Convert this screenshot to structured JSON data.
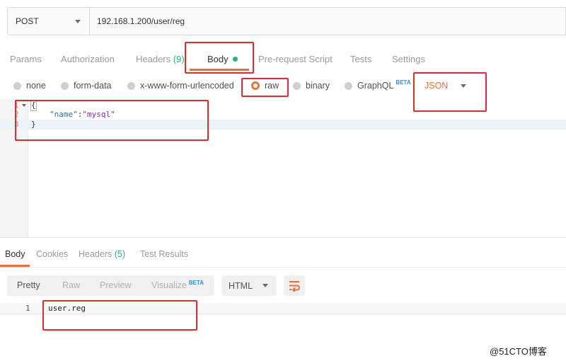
{
  "request": {
    "method": "POST",
    "url": "192.168.1.200/user/reg"
  },
  "request_tabs": {
    "params": "Params",
    "authorization": "Authorization",
    "headers": "Headers",
    "headers_count": "(9)",
    "body": "Body",
    "prerequest": "Pre-request Script",
    "tests": "Tests",
    "settings": "Settings"
  },
  "body_types": {
    "none": "none",
    "form_data": "form-data",
    "urlencoded": "x-www-form-urlencoded",
    "raw": "raw",
    "binary": "binary",
    "graphql": "GraphQL",
    "graphql_badge": "BETA",
    "selected": "raw",
    "language": "JSON"
  },
  "editor": {
    "lines": [
      {
        "num": "1",
        "text": "{"
      },
      {
        "num": "2",
        "key": "\"name\"",
        "sep": ":",
        "value": "\"mysql\""
      },
      {
        "num": "3",
        "text": "}"
      }
    ]
  },
  "response_tabs": {
    "body": "Body",
    "cookies": "Cookies",
    "headers": "Headers",
    "headers_count": "(5)",
    "test_results": "Test Results"
  },
  "response_view": {
    "pretty": "Pretty",
    "raw": "Raw",
    "preview": "Preview",
    "visualize": "Visualize",
    "visualize_badge": "BETA",
    "format": "HTML"
  },
  "response_body": {
    "lines": [
      {
        "num": "1",
        "text": "user.reg"
      }
    ]
  },
  "watermark": "@51CTO博客",
  "colors": {
    "accent": "#f26b3a",
    "success": "#26b47f",
    "annotation": "#e02b2b",
    "beta": "#2f8fdf"
  }
}
